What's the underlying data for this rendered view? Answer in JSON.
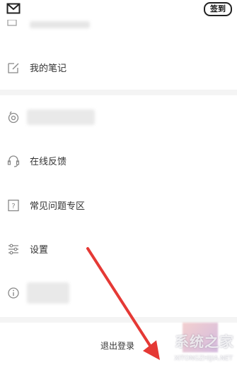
{
  "header": {
    "checkin_label": "签到",
    "icons": [
      "mail-icon"
    ]
  },
  "menu": [
    {
      "label": "我的笔记",
      "icon": "edit-icon"
    },
    {
      "label": "",
      "icon": "eye-refresh-icon",
      "blurred": true
    },
    {
      "label": "在线反馈",
      "icon": "headset-icon"
    },
    {
      "label": "常见问题专区",
      "icon": "question-icon"
    },
    {
      "label": "设置",
      "icon": "settings-sliders-icon"
    },
    {
      "label": "",
      "icon": "info-icon",
      "blurred": true
    }
  ],
  "logout": {
    "label": "退出登录"
  },
  "annotation": {
    "arrow_color": "#e53935"
  },
  "watermark": {
    "text": "系统之家",
    "url": "XITONGZHIJIA.NET"
  }
}
